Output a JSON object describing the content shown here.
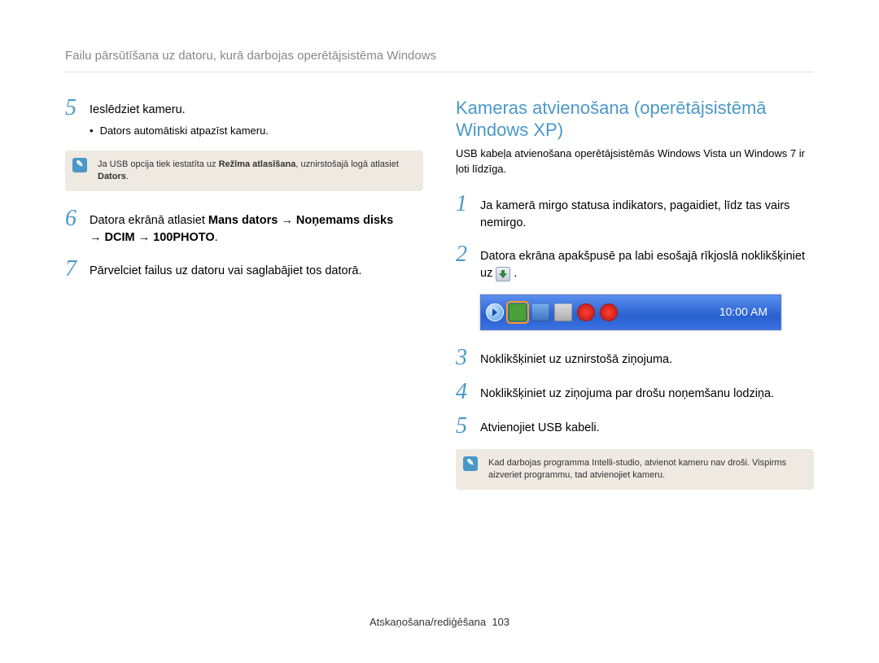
{
  "header": "Failu pārsūtīšana uz datoru, kurā darbojas operētājsistēma Windows",
  "left": {
    "steps": {
      "5": {
        "num": "5",
        "text": "Ieslēdziet kameru.",
        "bullet": "Dators automātiski atpazīst kameru."
      },
      "6": {
        "num": "6",
        "text1": "Datora ekrānā atlasiet ",
        "bold1": "Mans dators",
        "arrow": " → ",
        "bold2": "Noņemams disks",
        "line2a": " → ",
        "bold3": "DCIM",
        "line2b": " → ",
        "bold4": "100PHOTO",
        "end": "."
      },
      "7": {
        "num": "7",
        "text": "Pārvelciet failus uz datoru vai saglabājiet tos datorā."
      }
    },
    "note": {
      "text1": "Ja USB opcija tiek iestatīta uz ",
      "bold1": "Režīma atlasīšana",
      "text2": ", uznirstošajā logā atlasiet ",
      "bold2": "Dators",
      "text3": "."
    }
  },
  "right": {
    "title": "Kameras atvienošana (operētājsistēmā Windows XP)",
    "sub": "USB kabeļa atvienošana operētājsistēmās Windows Vista un Windows 7 ir ļoti līdzīga.",
    "steps": {
      "1": {
        "num": "1",
        "text": "Ja kamerā mirgo statusa indikators, pagaidiet, līdz tas vairs nemirgo."
      },
      "2": {
        "num": "2",
        "text1": "Datora ekrāna apakšpusē pa labi esošajā rīkjoslā noklikšķiniet uz ",
        "text2": "."
      },
      "3": {
        "num": "3",
        "text": "Noklikšķiniet uz uznirstošā ziņojuma."
      },
      "4": {
        "num": "4",
        "text": "Noklikšķiniet uz ziņojuma par drošu noņemšanu lodziņa."
      },
      "5": {
        "num": "5",
        "text": "Atvienojiet USB kabeli."
      }
    },
    "taskbar": {
      "time": "10:00 AM"
    },
    "note": "Kad darbojas programma Intelli-studio, atvienot kameru nav droši. Vispirms aizveriet programmu, tad atvienojiet kameru."
  },
  "footer": {
    "section": "Atskaņošana/rediģēšana",
    "page": "103"
  }
}
